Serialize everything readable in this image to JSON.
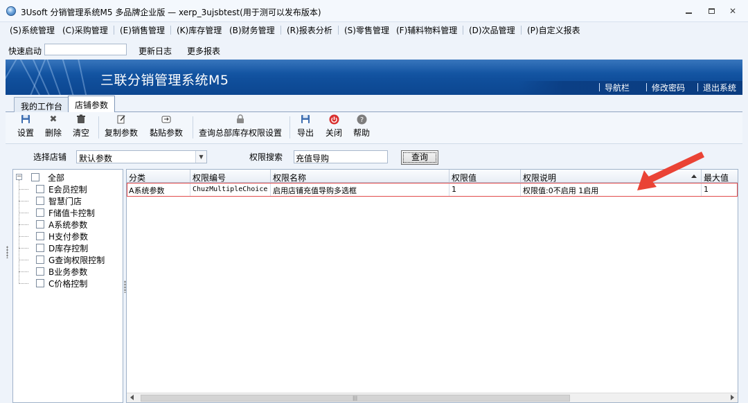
{
  "window": {
    "title": "3Usoft 分销管理系统M5 多品牌企业版 — xerp_3ujsbtest(用于测可以发布版本)"
  },
  "menu": [
    {
      "label": "(S)系统管理"
    },
    {
      "label": "(C)采购管理"
    },
    {
      "label": "(E)销售管理"
    },
    {
      "label": "(K)库存管理"
    },
    {
      "label": "(B)财务管理"
    },
    {
      "label": "(R)报表分析"
    },
    {
      "label": "(S)零售管理"
    },
    {
      "label": "(F)辅料物料管理"
    },
    {
      "label": "(D)次品管理"
    },
    {
      "label": "(P)自定义报表"
    }
  ],
  "quickbar": {
    "label": "快速启动",
    "input_value": "",
    "links": [
      "更新日志",
      "更多报表"
    ]
  },
  "banner": {
    "title": "三联分销管理系统M5",
    "links": [
      "导航栏",
      "修改密码",
      "退出系统"
    ]
  },
  "tabs": [
    {
      "label": "我的工作台",
      "active": false
    },
    {
      "label": "店铺参数",
      "active": true
    }
  ],
  "toolbar": {
    "buttons": [
      {
        "label": "设置",
        "icon": "save-icon"
      },
      {
        "label": "删除",
        "icon": "delete-icon"
      },
      {
        "label": "清空",
        "icon": "clear-icon"
      },
      {
        "label": "复制参数",
        "icon": "copy-icon"
      },
      {
        "label": "黏贴参数",
        "icon": "paste-icon"
      },
      {
        "label": "查询总部库存权限设置",
        "icon": "lock-icon"
      },
      {
        "label": "导出",
        "icon": "export-icon"
      },
      {
        "label": "关闭",
        "icon": "close-icon"
      },
      {
        "label": "帮助",
        "icon": "help-icon"
      }
    ]
  },
  "filter": {
    "store_label": "选择店铺",
    "store_value": "默认参数",
    "search_label": "权限搜索",
    "search_value": "充值导购",
    "query_label": "查询"
  },
  "tree": {
    "root": "全部",
    "items": [
      "E会员控制",
      "智慧门店",
      "F储值卡控制",
      "A系统参数",
      "H支付参数",
      "D库存控制",
      "G查询权限控制",
      "B业务参数",
      "C价格控制"
    ]
  },
  "grid": {
    "columns": [
      "分类",
      "权限编号",
      "权限名称",
      "权限值",
      "权限说明",
      "最大值"
    ],
    "rows": [
      {
        "category": "A系统参数",
        "code": "ChuzMultipleChoice",
        "name": "启用店铺充值导购多选框",
        "value": "1",
        "desc": "权限值:0不启用 1启用",
        "max": "1"
      }
    ]
  },
  "colors": {
    "banner_blue": "#104f9c",
    "highlight_red": "#e14b4b"
  }
}
